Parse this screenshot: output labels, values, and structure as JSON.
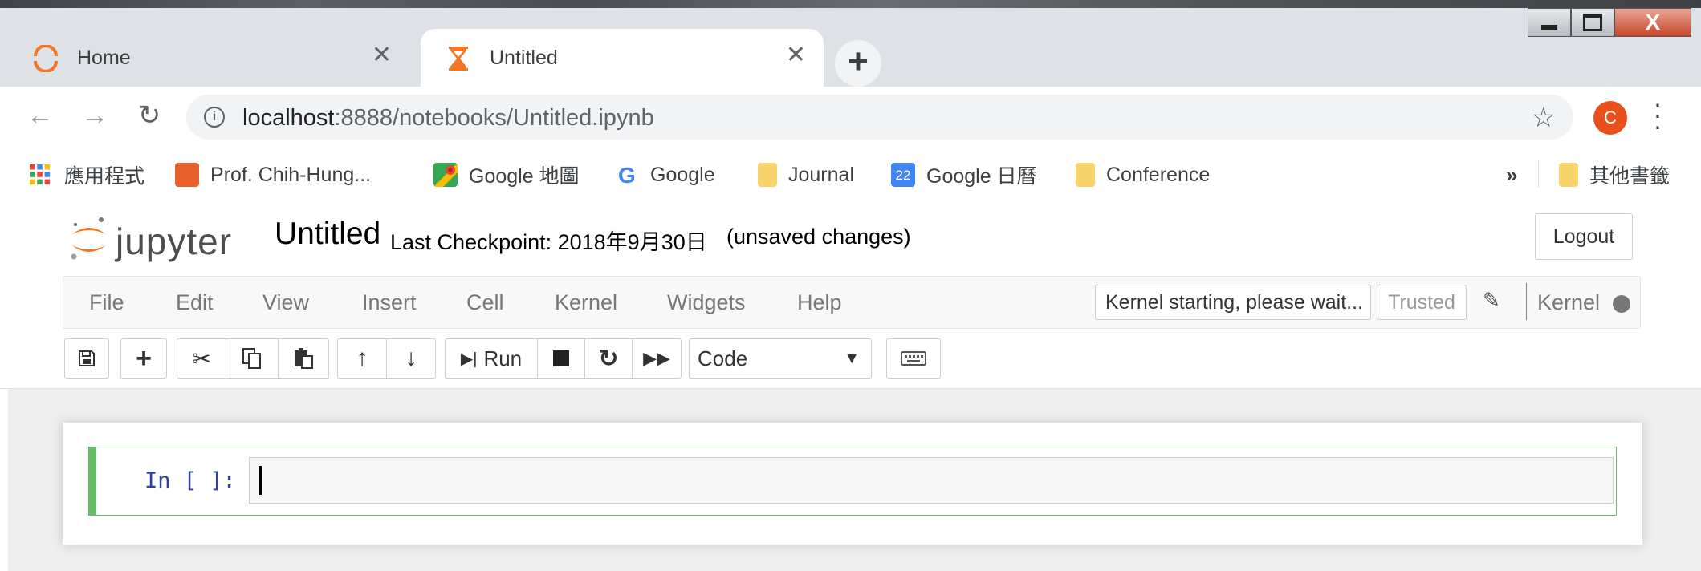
{
  "browser": {
    "tabs": [
      {
        "title": "Home",
        "icon": "jupyter-spinner-icon",
        "active": false
      },
      {
        "title": "Untitled",
        "icon": "hourglass-icon",
        "active": true
      }
    ],
    "close_glyph": "✕",
    "new_tab_glyph": "+",
    "window_controls": {
      "close_glyph": "X"
    },
    "address": {
      "host": "localhost",
      "rest": ":8888/notebooks/Untitled.ipynb"
    },
    "profile_initial": "C",
    "bookmarks": [
      {
        "label": "應用程式",
        "icon": "apps-grid-icon"
      },
      {
        "label": "Prof. Chih-Hung...",
        "icon": "orange-page-icon"
      },
      {
        "label": "Google 地圖",
        "icon": "google-maps-icon"
      },
      {
        "label": "Google",
        "icon": "google-g-icon"
      },
      {
        "label": "Journal",
        "icon": "folder-icon"
      },
      {
        "label": "Google 日曆",
        "icon": "google-calendar-icon",
        "badge": "22"
      },
      {
        "label": "Conference",
        "icon": "folder-icon"
      }
    ],
    "overflow_chevron": "»",
    "other_bookmarks": "其他書籤"
  },
  "jupyter": {
    "logo_text": "jupyter",
    "notebook_name": "Untitled",
    "checkpoint": "Last Checkpoint: 2018年9月30日",
    "unsaved": "(unsaved changes)",
    "logout": "Logout",
    "menu": [
      "File",
      "Edit",
      "View",
      "Insert",
      "Cell",
      "Kernel",
      "Widgets",
      "Help"
    ],
    "kernel_status": "Kernel starting, please wait...",
    "trusted": "Trusted",
    "kernel_label": "Kernel",
    "toolbar": {
      "run_label": "Run",
      "cell_type": "Code"
    },
    "cell": {
      "prompt": "In [ ]:",
      "source": ""
    }
  },
  "colors": {
    "accent_orange": "#f37626",
    "cell_selected_border": "#66bb6a",
    "prompt_blue": "#303f9f"
  }
}
